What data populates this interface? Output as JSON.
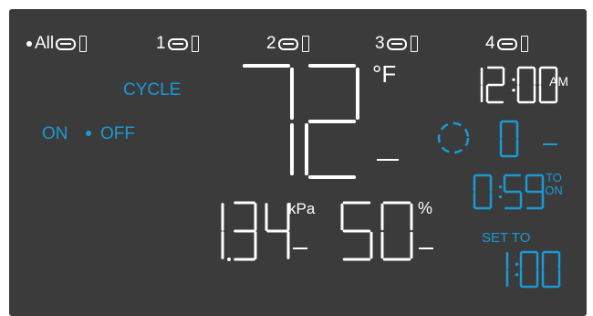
{
  "ports": [
    {
      "label": "All",
      "selected": true
    },
    {
      "label": "1",
      "selected": false
    },
    {
      "label": "2",
      "selected": false
    },
    {
      "label": "3",
      "selected": false
    },
    {
      "label": "4",
      "selected": false
    }
  ],
  "mode": {
    "label": "CYCLE",
    "on_label": "ON",
    "off_label": "OFF",
    "selected": "OFF"
  },
  "temperature": {
    "value": "72",
    "unit": "°F"
  },
  "clock": {
    "time": "12:00",
    "meridiem": "AM"
  },
  "level": {
    "value": "0"
  },
  "countdown": {
    "value": "0:59",
    "label_top": "TO",
    "label_bottom": "ON"
  },
  "vpd": {
    "value": "1.34",
    "unit": "kPa"
  },
  "humidity": {
    "value": "50",
    "unit": "%"
  },
  "set_to": {
    "label": "SET TO",
    "value": "1:00"
  },
  "colors": {
    "panel": "#3b3b3b",
    "white": "#ffffff",
    "accent": "#1a9ad6"
  }
}
